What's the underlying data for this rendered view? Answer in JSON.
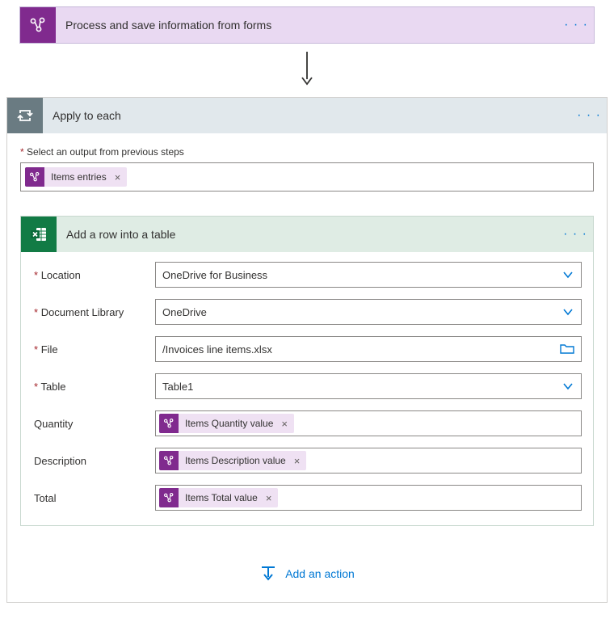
{
  "colors": {
    "aiBuilderPurple": "#802a8e",
    "aiBuilderLight": "#e9d9f2",
    "loopGrey": "#6a7b82",
    "loopLight": "#e1e8ec",
    "excelGreen": "#127b45",
    "excelLight": "#dfece4",
    "linkBlue": "#0078d4",
    "requiredRed": "#a4262c"
  },
  "topAction": {
    "title": "Process and save information from forms"
  },
  "applyToEach": {
    "title": "Apply to each",
    "selectOutputLabel": "Select an output from previous steps",
    "selectedToken": "Items entries"
  },
  "excelAction": {
    "title": "Add a row into a table",
    "fields": {
      "location": {
        "label": "Location",
        "required": true,
        "value": "OneDrive for Business",
        "icon": "chevron"
      },
      "documentLibrary": {
        "label": "Document Library",
        "required": true,
        "value": "OneDrive",
        "icon": "chevron"
      },
      "file": {
        "label": "File",
        "required": true,
        "value": "/Invoices line items.xlsx",
        "icon": "folder"
      },
      "table": {
        "label": "Table",
        "required": true,
        "value": "Table1",
        "icon": "chevron"
      },
      "quantity": {
        "label": "Quantity",
        "required": false,
        "token": "Items Quantity value"
      },
      "description": {
        "label": "Description",
        "required": false,
        "token": "Items Description value"
      },
      "total": {
        "label": "Total",
        "required": false,
        "token": "Items Total value"
      }
    }
  },
  "addAction": {
    "label": "Add an action"
  }
}
